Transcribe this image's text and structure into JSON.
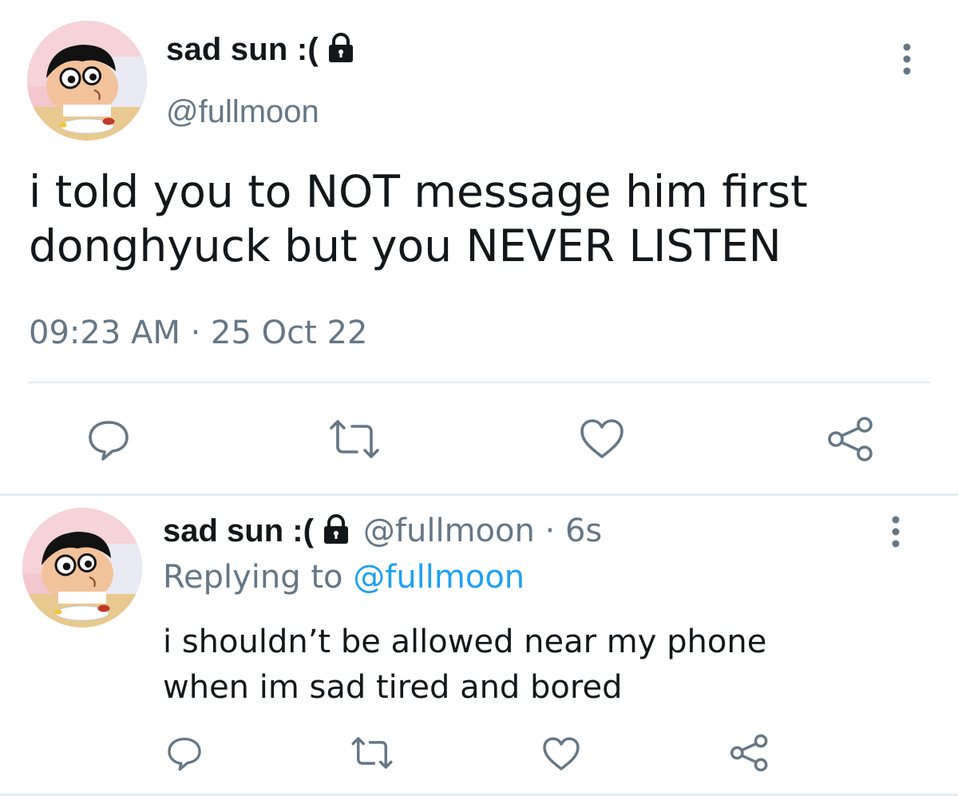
{
  "main_tweet": {
    "display_name": "sad sun :(",
    "handle": "@fullmoon",
    "text_lines": [
      "i told you to NOT message him first",
      "donghyuck but you NEVER LISTEN"
    ],
    "timestamp": "09:23 AM · 25 Oct 22",
    "avatar_icon": "cartoon-boy-avatar",
    "locked_icon": "lock-icon",
    "actions": [
      "reply-icon",
      "retweet-icon",
      "like-icon",
      "share-icon"
    ]
  },
  "reply_tweet": {
    "display_name": "sad sun :(",
    "handle_time": "@fullmoon · 6s",
    "replying_prefix": "Replying to",
    "replying_mention": "@fullmoon",
    "text_lines": [
      "i shouldn’t be allowed near my phone",
      "when im sad tired and bored"
    ],
    "avatar_icon": "cartoon-boy-avatar",
    "locked_icon": "lock-icon",
    "actions": [
      "reply-icon",
      "retweet-icon",
      "like-icon",
      "share-icon"
    ]
  },
  "colors": {
    "text_primary": "#14171a",
    "text_secondary": "#657786",
    "link": "#1da1f2",
    "divider": "#e6ecf0"
  }
}
